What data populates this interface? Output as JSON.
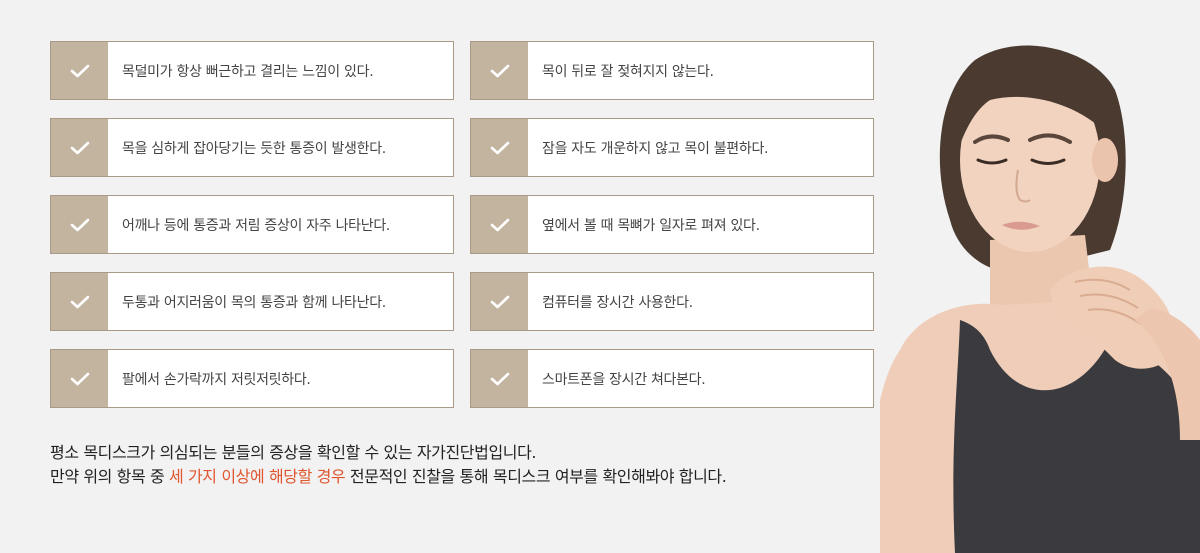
{
  "checklist": {
    "items": [
      {
        "text": "목덜미가 항상 뻐근하고 결리는 느낌이 있다."
      },
      {
        "text": "목이 뒤로 잘 젖혀지지 않는다."
      },
      {
        "text": "목을 심하게 잡아당기는 듯한 통증이 발생한다."
      },
      {
        "text": "잠을 자도 개운하지 않고 목이 불편하다."
      },
      {
        "text": "어깨나 등에 통증과 저림 증상이 자주 나타난다."
      },
      {
        "text": "옆에서 볼 때 목뼈가 일자로 펴져 있다."
      },
      {
        "text": "두통과 어지러움이 목의 통증과 함께 나타난다."
      },
      {
        "text": "컴퓨터를 장시간 사용한다."
      },
      {
        "text": "팔에서 손가락까지 저릿저릿하다."
      },
      {
        "text": "스마트폰을 장시간 쳐다본다."
      }
    ],
    "check_icon": "checkmark-icon",
    "accent_color": "#c3b4a0",
    "border_color": "#a99a88"
  },
  "footer": {
    "line1": "평소 목디스크가 의심되는 분들의 증상을 확인할 수 있는 자가진단법입니다.",
    "line2_before": "만약 위의 항목 중 ",
    "line2_highlight": "세 가지 이상에 해당할 경우",
    "line2_after": " 전문적인 진찰을 통해 목디스크 여부를 확인해봐야 합니다.",
    "highlight_color": "#e0562e"
  },
  "photo": {
    "subject": "woman-holding-neck-in-pain"
  }
}
